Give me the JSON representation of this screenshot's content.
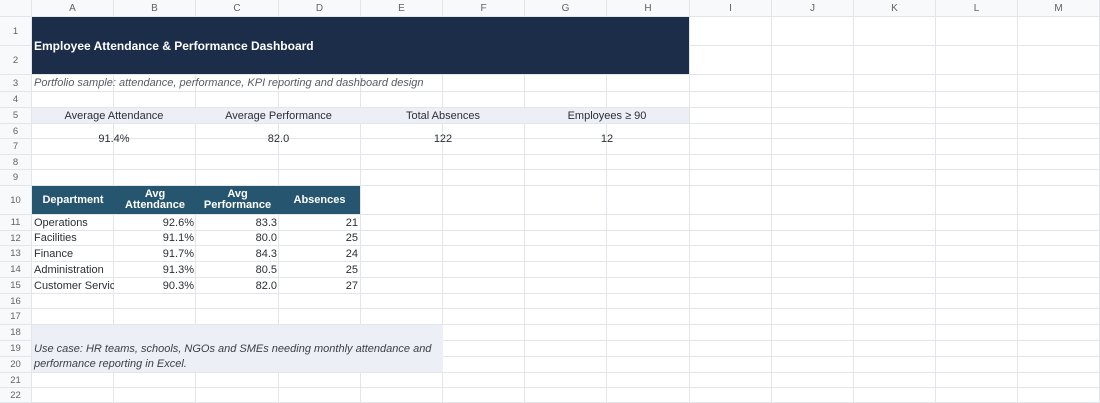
{
  "columns": [
    "A",
    "B",
    "C",
    "D",
    "E",
    "F",
    "G",
    "H",
    "I",
    "J",
    "K",
    "L",
    "M"
  ],
  "rows": [
    "1",
    "2",
    "3",
    "4",
    "5",
    "6",
    "7",
    "8",
    "9",
    "10",
    "11",
    "12",
    "13",
    "14",
    "15",
    "16",
    "17",
    "18",
    "19",
    "20",
    "21",
    "22"
  ],
  "dashboard": {
    "title": "Employee Attendance & Performance Dashboard",
    "subtitle": "Portfolio sample: attendance, performance, KPI reporting and dashboard design",
    "kpis": [
      {
        "label": "Average Attendance",
        "value": "91.4%"
      },
      {
        "label": "Average Performance",
        "value": "82.0"
      },
      {
        "label": "Total Absences",
        "value": "122"
      },
      {
        "label": "Employees ≥ 90",
        "value": "12"
      }
    ],
    "table": {
      "headers": [
        "Department",
        "Avg Attendance",
        "Avg Performance",
        "Absences"
      ],
      "rows": [
        [
          "Operations",
          "92.6%",
          "83.3",
          "21"
        ],
        [
          "Facilities",
          "91.1%",
          "80.0",
          "25"
        ],
        [
          "Finance",
          "91.7%",
          "84.3",
          "24"
        ],
        [
          "Administration",
          "91.3%",
          "80.5",
          "25"
        ],
        [
          "Customer Service",
          "90.3%",
          "82.0",
          "27"
        ]
      ]
    },
    "note_lines": [
      "Use case: HR teams, schools, NGOs and SMEs needing monthly attendance and",
      "performance reporting in Excel."
    ]
  },
  "colors": {
    "title_bg": "#1c2d4a",
    "table_header_bg": "#26566f",
    "panel_bg": "#eceff5"
  }
}
